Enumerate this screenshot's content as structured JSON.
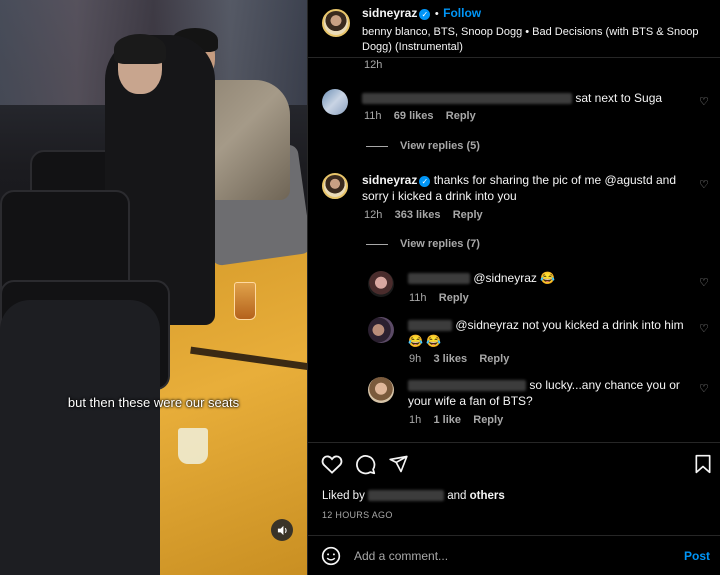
{
  "video": {
    "caption": "but then these were our seats"
  },
  "header": {
    "username": "sidneyraz",
    "follow_label": "Follow",
    "separator": "•",
    "audio": "benny blanco, BTS, Snoop Dogg • Bad Decisions (with BTS & Snoop Dogg) (Instrumental)"
  },
  "comments": [
    {
      "prev_time": "12h"
    },
    {
      "text": "sat next to Suga",
      "time": "11h",
      "likes": "69 likes",
      "reply": "Reply",
      "view_replies": "View replies (5)"
    },
    {
      "username": "sidneyraz",
      "text": "thanks for sharing the pic of me @agustd and sorry i kicked a drink into you",
      "time": "12h",
      "likes": "363 likes",
      "reply": "Reply",
      "view_replies": "View replies (7)"
    }
  ],
  "replies": [
    {
      "text": "@sidneyraz 😂",
      "time": "11h",
      "reply": "Reply"
    },
    {
      "text": "@sidneyraz not you kicked a drink into him 😂 😂",
      "time": "9h",
      "likes": "3 likes",
      "reply": "Reply"
    },
    {
      "text": "so lucky...any chance you or your wife a fan of BTS?",
      "time": "1h",
      "likes": "1 like",
      "reply": "Reply"
    }
  ],
  "footer": {
    "liked_by": "Liked by",
    "and": "and",
    "others": "others",
    "timestamp": "12 HOURS AGO",
    "comment_placeholder": "Add a comment...",
    "post_label": "Post"
  }
}
